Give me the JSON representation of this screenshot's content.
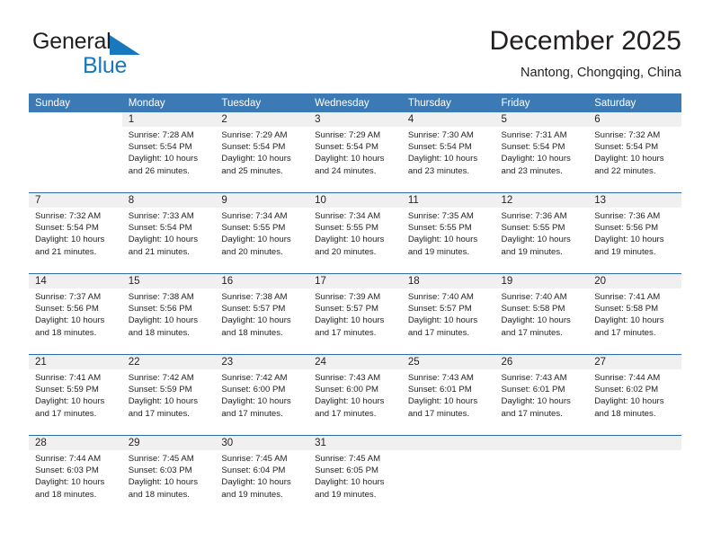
{
  "brand": {
    "name_part1": "General",
    "name_part2": "Blue",
    "logo_icon": "triangle-flag-icon",
    "accent_color": "#1878be"
  },
  "header": {
    "title": "December 2025",
    "subtitle": "Nantong, Chongqing, China"
  },
  "theme": {
    "header_row_bg": "#3b7ab5",
    "week_divider": "#2d6ca8",
    "day_number_band_bg": "#f0f0f0",
    "text_color": "#231f20"
  },
  "calendar": {
    "weekday_headers": [
      "Sunday",
      "Monday",
      "Tuesday",
      "Wednesday",
      "Thursday",
      "Friday",
      "Saturday"
    ],
    "weeks": [
      [
        {
          "day": "",
          "sunrise": "",
          "sunset": "",
          "daylight_line1": "",
          "daylight_line2": "",
          "blank": true
        },
        {
          "day": "1",
          "sunrise": "Sunrise: 7:28 AM",
          "sunset": "Sunset: 5:54 PM",
          "daylight_line1": "Daylight: 10 hours",
          "daylight_line2": "and 26 minutes."
        },
        {
          "day": "2",
          "sunrise": "Sunrise: 7:29 AM",
          "sunset": "Sunset: 5:54 PM",
          "daylight_line1": "Daylight: 10 hours",
          "daylight_line2": "and 25 minutes."
        },
        {
          "day": "3",
          "sunrise": "Sunrise: 7:29 AM",
          "sunset": "Sunset: 5:54 PM",
          "daylight_line1": "Daylight: 10 hours",
          "daylight_line2": "and 24 minutes."
        },
        {
          "day": "4",
          "sunrise": "Sunrise: 7:30 AM",
          "sunset": "Sunset: 5:54 PM",
          "daylight_line1": "Daylight: 10 hours",
          "daylight_line2": "and 23 minutes."
        },
        {
          "day": "5",
          "sunrise": "Sunrise: 7:31 AM",
          "sunset": "Sunset: 5:54 PM",
          "daylight_line1": "Daylight: 10 hours",
          "daylight_line2": "and 23 minutes."
        },
        {
          "day": "6",
          "sunrise": "Sunrise: 7:32 AM",
          "sunset": "Sunset: 5:54 PM",
          "daylight_line1": "Daylight: 10 hours",
          "daylight_line2": "and 22 minutes."
        }
      ],
      [
        {
          "day": "7",
          "sunrise": "Sunrise: 7:32 AM",
          "sunset": "Sunset: 5:54 PM",
          "daylight_line1": "Daylight: 10 hours",
          "daylight_line2": "and 21 minutes."
        },
        {
          "day": "8",
          "sunrise": "Sunrise: 7:33 AM",
          "sunset": "Sunset: 5:54 PM",
          "daylight_line1": "Daylight: 10 hours",
          "daylight_line2": "and 21 minutes."
        },
        {
          "day": "9",
          "sunrise": "Sunrise: 7:34 AM",
          "sunset": "Sunset: 5:55 PM",
          "daylight_line1": "Daylight: 10 hours",
          "daylight_line2": "and 20 minutes."
        },
        {
          "day": "10",
          "sunrise": "Sunrise: 7:34 AM",
          "sunset": "Sunset: 5:55 PM",
          "daylight_line1": "Daylight: 10 hours",
          "daylight_line2": "and 20 minutes."
        },
        {
          "day": "11",
          "sunrise": "Sunrise: 7:35 AM",
          "sunset": "Sunset: 5:55 PM",
          "daylight_line1": "Daylight: 10 hours",
          "daylight_line2": "and 19 minutes."
        },
        {
          "day": "12",
          "sunrise": "Sunrise: 7:36 AM",
          "sunset": "Sunset: 5:55 PM",
          "daylight_line1": "Daylight: 10 hours",
          "daylight_line2": "and 19 minutes."
        },
        {
          "day": "13",
          "sunrise": "Sunrise: 7:36 AM",
          "sunset": "Sunset: 5:56 PM",
          "daylight_line1": "Daylight: 10 hours",
          "daylight_line2": "and 19 minutes."
        }
      ],
      [
        {
          "day": "14",
          "sunrise": "Sunrise: 7:37 AM",
          "sunset": "Sunset: 5:56 PM",
          "daylight_line1": "Daylight: 10 hours",
          "daylight_line2": "and 18 minutes."
        },
        {
          "day": "15",
          "sunrise": "Sunrise: 7:38 AM",
          "sunset": "Sunset: 5:56 PM",
          "daylight_line1": "Daylight: 10 hours",
          "daylight_line2": "and 18 minutes."
        },
        {
          "day": "16",
          "sunrise": "Sunrise: 7:38 AM",
          "sunset": "Sunset: 5:57 PM",
          "daylight_line1": "Daylight: 10 hours",
          "daylight_line2": "and 18 minutes."
        },
        {
          "day": "17",
          "sunrise": "Sunrise: 7:39 AM",
          "sunset": "Sunset: 5:57 PM",
          "daylight_line1": "Daylight: 10 hours",
          "daylight_line2": "and 17 minutes."
        },
        {
          "day": "18",
          "sunrise": "Sunrise: 7:40 AM",
          "sunset": "Sunset: 5:57 PM",
          "daylight_line1": "Daylight: 10 hours",
          "daylight_line2": "and 17 minutes."
        },
        {
          "day": "19",
          "sunrise": "Sunrise: 7:40 AM",
          "sunset": "Sunset: 5:58 PM",
          "daylight_line1": "Daylight: 10 hours",
          "daylight_line2": "and 17 minutes."
        },
        {
          "day": "20",
          "sunrise": "Sunrise: 7:41 AM",
          "sunset": "Sunset: 5:58 PM",
          "daylight_line1": "Daylight: 10 hours",
          "daylight_line2": "and 17 minutes."
        }
      ],
      [
        {
          "day": "21",
          "sunrise": "Sunrise: 7:41 AM",
          "sunset": "Sunset: 5:59 PM",
          "daylight_line1": "Daylight: 10 hours",
          "daylight_line2": "and 17 minutes."
        },
        {
          "day": "22",
          "sunrise": "Sunrise: 7:42 AM",
          "sunset": "Sunset: 5:59 PM",
          "daylight_line1": "Daylight: 10 hours",
          "daylight_line2": "and 17 minutes."
        },
        {
          "day": "23",
          "sunrise": "Sunrise: 7:42 AM",
          "sunset": "Sunset: 6:00 PM",
          "daylight_line1": "Daylight: 10 hours",
          "daylight_line2": "and 17 minutes."
        },
        {
          "day": "24",
          "sunrise": "Sunrise: 7:43 AM",
          "sunset": "Sunset: 6:00 PM",
          "daylight_line1": "Daylight: 10 hours",
          "daylight_line2": "and 17 minutes."
        },
        {
          "day": "25",
          "sunrise": "Sunrise: 7:43 AM",
          "sunset": "Sunset: 6:01 PM",
          "daylight_line1": "Daylight: 10 hours",
          "daylight_line2": "and 17 minutes."
        },
        {
          "day": "26",
          "sunrise": "Sunrise: 7:43 AM",
          "sunset": "Sunset: 6:01 PM",
          "daylight_line1": "Daylight: 10 hours",
          "daylight_line2": "and 17 minutes."
        },
        {
          "day": "27",
          "sunrise": "Sunrise: 7:44 AM",
          "sunset": "Sunset: 6:02 PM",
          "daylight_line1": "Daylight: 10 hours",
          "daylight_line2": "and 18 minutes."
        }
      ],
      [
        {
          "day": "28",
          "sunrise": "Sunrise: 7:44 AM",
          "sunset": "Sunset: 6:03 PM",
          "daylight_line1": "Daylight: 10 hours",
          "daylight_line2": "and 18 minutes."
        },
        {
          "day": "29",
          "sunrise": "Sunrise: 7:45 AM",
          "sunset": "Sunset: 6:03 PM",
          "daylight_line1": "Daylight: 10 hours",
          "daylight_line2": "and 18 minutes."
        },
        {
          "day": "30",
          "sunrise": "Sunrise: 7:45 AM",
          "sunset": "Sunset: 6:04 PM",
          "daylight_line1": "Daylight: 10 hours",
          "daylight_line2": "and 19 minutes."
        },
        {
          "day": "31",
          "sunrise": "Sunrise: 7:45 AM",
          "sunset": "Sunset: 6:05 PM",
          "daylight_line1": "Daylight: 10 hours",
          "daylight_line2": "and 19 minutes."
        },
        {
          "day": "",
          "sunrise": "",
          "sunset": "",
          "daylight_line1": "",
          "daylight_line2": "",
          "empty": true
        },
        {
          "day": "",
          "sunrise": "",
          "sunset": "",
          "daylight_line1": "",
          "daylight_line2": "",
          "empty": true
        },
        {
          "day": "",
          "sunrise": "",
          "sunset": "",
          "daylight_line1": "",
          "daylight_line2": "",
          "empty": true
        }
      ]
    ]
  }
}
